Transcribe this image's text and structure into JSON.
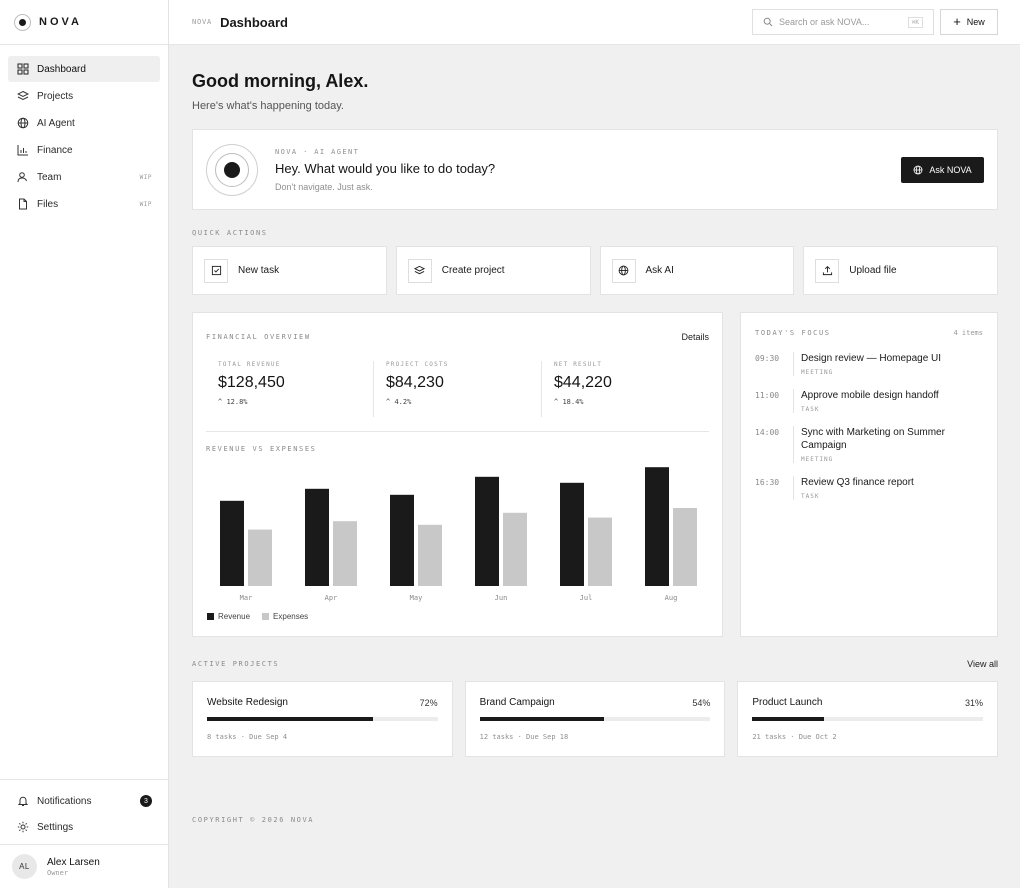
{
  "brand": {
    "name": "NOVA"
  },
  "sidebar": {
    "items": [
      {
        "label": "Dashboard",
        "icon": "grid-icon",
        "badge": ""
      },
      {
        "label": "Projects",
        "icon": "layers-icon",
        "badge": ""
      },
      {
        "label": "AI Agent",
        "icon": "globe-icon",
        "badge": ""
      },
      {
        "label": "Finance",
        "icon": "bar-chart-icon",
        "badge": ""
      },
      {
        "label": "Team",
        "icon": "user-icon",
        "badge": "WIP"
      },
      {
        "label": "Files",
        "icon": "file-icon",
        "badge": "WIP"
      }
    ],
    "notifications": {
      "label": "Notifications",
      "count": "3"
    },
    "settings": {
      "label": "Settings"
    },
    "user": {
      "initials": "AL",
      "name": "Alex Larsen",
      "role": "Owner"
    }
  },
  "topbar": {
    "crumb": "NOVA",
    "title": "Dashboard",
    "search_placeholder": "Search or ask NOVA...",
    "search_shortcut": "⌘K",
    "new_label": "New"
  },
  "greeting": {
    "title": "Good morning, Alex.",
    "subtitle": "Here's what's happening today."
  },
  "agent": {
    "kicker": "NOVA · AI AGENT",
    "question": "Hey. What would you like to do today?",
    "sub": "Don't navigate. Just ask.",
    "button": "Ask NOVA"
  },
  "quick_actions": {
    "label": "QUICK ACTIONS",
    "items": [
      {
        "label": "New task",
        "icon": "check-square-icon"
      },
      {
        "label": "Create project",
        "icon": "layers-icon"
      },
      {
        "label": "Ask AI",
        "icon": "globe-icon"
      },
      {
        "label": "Upload file",
        "icon": "upload-icon"
      }
    ]
  },
  "financial": {
    "label": "FINANCIAL OVERVIEW",
    "details": "Details",
    "metrics": [
      {
        "label": "TOTAL REVENUE",
        "value": "$128,450",
        "delta": "12.8%"
      },
      {
        "label": "PROJECT COSTS",
        "value": "$84,230",
        "delta": "4.2%"
      },
      {
        "label": "NET RESULT",
        "value": "$44,220",
        "delta": "18.4%"
      }
    ],
    "chart_label": "REVENUE VS EXPENSES"
  },
  "chart_data": {
    "type": "bar",
    "title": "REVENUE VS EXPENSES",
    "categories": [
      "Mar",
      "Apr",
      "May",
      "Jun",
      "Jul",
      "Aug"
    ],
    "series": [
      {
        "name": "Revenue",
        "color": "#1a1a1a",
        "values": [
          71,
          81,
          76,
          91,
          86,
          99
        ]
      },
      {
        "name": "Expenses",
        "color": "#c8c8c8",
        "values": [
          47,
          54,
          51,
          61,
          57,
          65
        ]
      }
    ],
    "ylim": [
      0,
      100
    ],
    "grid": false,
    "legend": "bottom-left"
  },
  "focus": {
    "label": "TODAY'S FOCUS",
    "count": "4 items",
    "items": [
      {
        "time": "09:30",
        "title": "Design review — Homepage UI",
        "tag": "MEETING"
      },
      {
        "time": "11:00",
        "title": "Approve mobile design handoff",
        "tag": "TASK"
      },
      {
        "time": "14:00",
        "title": "Sync with Marketing on Summer Campaign",
        "tag": "MEETING"
      },
      {
        "time": "16:30",
        "title": "Review Q3 finance report",
        "tag": "TASK"
      }
    ]
  },
  "projects": {
    "label": "ACTIVE PROJECTS",
    "view_all": "View all",
    "items": [
      {
        "name": "Website Redesign",
        "pct": "72%",
        "progress": 72,
        "meta": "8 tasks · Due Sep 4"
      },
      {
        "name": "Brand Campaign",
        "pct": "54%",
        "progress": 54,
        "meta": "12 tasks · Due Sep 18"
      },
      {
        "name": "Product Launch",
        "pct": "31%",
        "progress": 31,
        "meta": "21 tasks · Due Oct 2"
      }
    ]
  },
  "footer": {
    "copyright": "COPYRIGHT © 2026 NOVA"
  }
}
